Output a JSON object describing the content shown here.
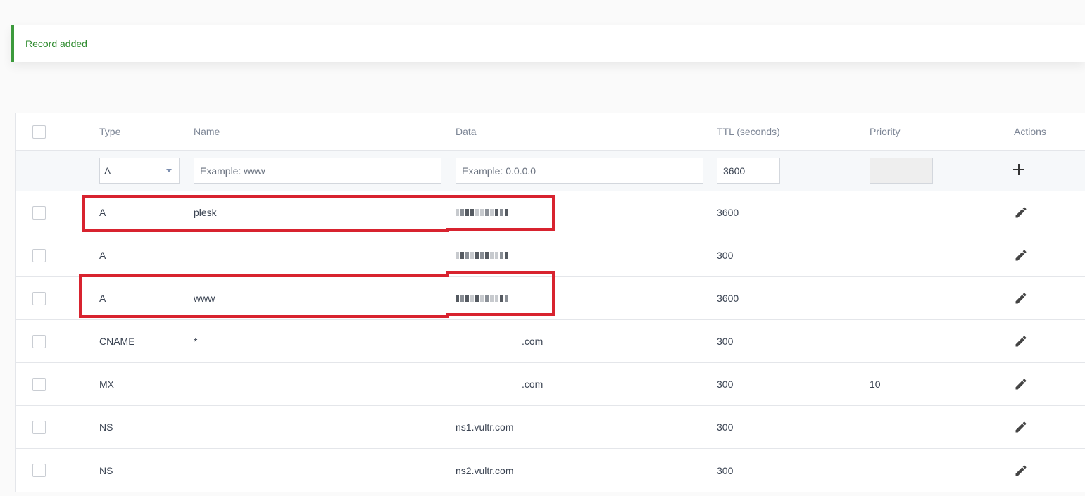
{
  "notice": {
    "message": "Record added"
  },
  "table": {
    "headers": {
      "type": "Type",
      "name": "Name",
      "data": "Data",
      "ttl": "TTL (seconds)",
      "priority": "Priority",
      "actions": "Actions"
    },
    "add_row": {
      "type_value": "A",
      "name_placeholder": "Example: www",
      "data_placeholder": "Example: 0.0.0.0",
      "ttl_value": "3600",
      "priority_value": ""
    },
    "rows": [
      {
        "type": "A",
        "name": "plesk",
        "data": "",
        "ttl": "3600",
        "priority": ""
      },
      {
        "type": "A",
        "name": "",
        "data": "",
        "ttl": "300",
        "priority": ""
      },
      {
        "type": "A",
        "name": "www",
        "data": "",
        "ttl": "3600",
        "priority": ""
      },
      {
        "type": "CNAME",
        "name": "*",
        "data": ".com",
        "ttl": "300",
        "priority": ""
      },
      {
        "type": "MX",
        "name": "",
        "data": ".com",
        "ttl": "300",
        "priority": "10"
      },
      {
        "type": "NS",
        "name": "",
        "data": "ns1.vultr.com",
        "ttl": "300",
        "priority": ""
      },
      {
        "type": "NS",
        "name": "",
        "data": "ns2.vultr.com",
        "ttl": "300",
        "priority": ""
      }
    ]
  },
  "colors": {
    "success": "#3c9a3c",
    "highlight": "#d8232f",
    "border": "#e4e6ea"
  },
  "icons": {
    "add": "plus-icon",
    "edit": "pencil-icon",
    "dropdown": "caret-down-icon"
  }
}
